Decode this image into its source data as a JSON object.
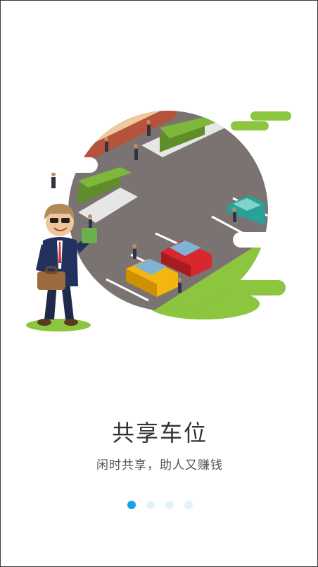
{
  "onboarding": {
    "title": "共享车位",
    "subtitle": "闲时共享，助人又赚钱",
    "illustration_icon": "parking-lot-businessman-illustration"
  },
  "pager": {
    "total_pages": 4,
    "current_page": 1,
    "active_color": "#1aa0ea",
    "inactive_color": "#e4f3fb"
  },
  "colors": {
    "grass": "#8cc63f",
    "asphalt": "#7a7372",
    "car_red": "#d9272e",
    "car_yellow": "#f3b50f",
    "car_teal": "#2aa198"
  }
}
